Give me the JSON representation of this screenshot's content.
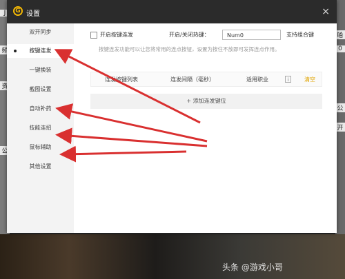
{
  "dialog": {
    "title": "设置",
    "logo_letter": "G",
    "close_glyph": "×"
  },
  "sidebar": {
    "items": [
      {
        "label": "双开同步"
      },
      {
        "label": "按键连发"
      },
      {
        "label": "一键换装"
      },
      {
        "label": "截图设置"
      },
      {
        "label": "自动补药"
      },
      {
        "label": "技能连招"
      },
      {
        "label": "鼠标辅助"
      },
      {
        "label": "其他设置"
      }
    ]
  },
  "content": {
    "enable_label": "开启按键连发",
    "hotkey_label": "开启/关闭热键：",
    "hotkey_value": "Num0",
    "combo_label": "支持组合键",
    "description": "按键连发功能可以让您将常用的连点按钮，设置为按住不放即可发挥连点作用。",
    "table": {
      "col_keys": "连发按键列表",
      "col_interval": "连发间隔（毫秒）",
      "col_job": "适用职业",
      "help_glyph": "i",
      "clear": "清空"
    },
    "add_button": "+ 添加连发键位"
  },
  "background": {
    "left_labels": [
      "J",
      "频",
      "资",
      "公"
    ],
    "right_labels": [
      "哈",
      "0",
      "公",
      "开"
    ]
  },
  "watermark": "头条 @游戏小哥",
  "colors": {
    "titlebar": "#2b2b2b",
    "accent_logo": "#f2b705",
    "arrow": "#d93030",
    "clear_link": "#e0a400"
  }
}
